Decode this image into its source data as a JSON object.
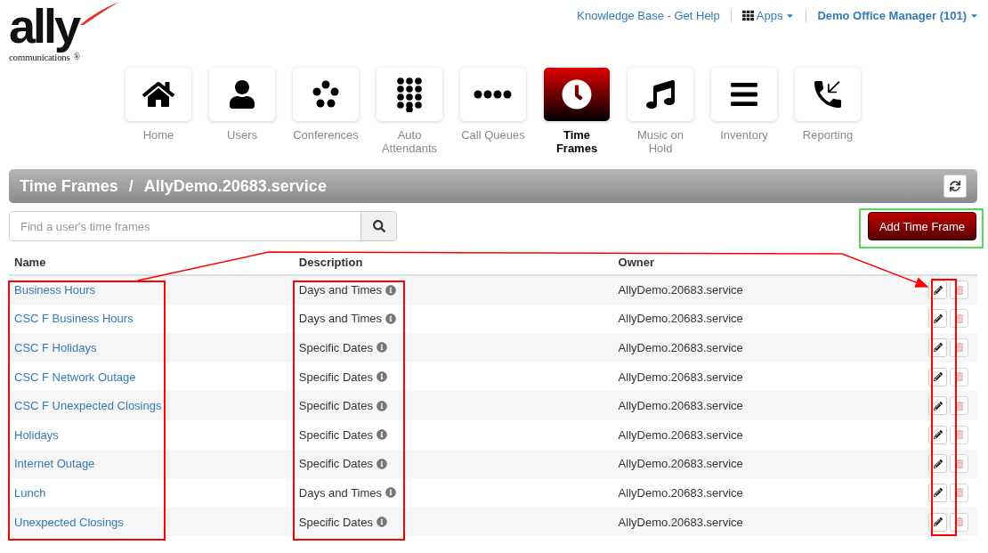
{
  "logo": {
    "wordmark": "ally",
    "tagline": "communications",
    "mark": "®"
  },
  "top_links": {
    "help": "Knowledge Base - Get Help",
    "apps": "Apps",
    "user": "Demo Office Manager (101)"
  },
  "nav": [
    {
      "label": "Home",
      "selected": false
    },
    {
      "label": "Users",
      "selected": false
    },
    {
      "label": "Conferences",
      "selected": false
    },
    {
      "label": "Auto Attendants",
      "selected": false
    },
    {
      "label": "Call Queues",
      "selected": false
    },
    {
      "label": "Time Frames",
      "selected": true
    },
    {
      "label": "Music on Hold",
      "selected": false
    },
    {
      "label": "Inventory",
      "selected": false
    },
    {
      "label": "Reporting",
      "selected": false
    }
  ],
  "title_bar": {
    "section": "Time Frames",
    "separator": "/",
    "domain": "AllyDemo.20683.service"
  },
  "search": {
    "placeholder": "Find a user's time frames"
  },
  "add_button": "Add Time Frame",
  "table": {
    "columns": [
      "Name",
      "Description",
      "Owner"
    ],
    "rows": [
      {
        "name": "Business Hours",
        "description": "Days and Times",
        "owner": "AllyDemo.20683.service"
      },
      {
        "name": "CSC F Business Hours",
        "description": "Days and Times",
        "owner": "AllyDemo.20683.service"
      },
      {
        "name": "CSC F Holidays",
        "description": "Specific Dates",
        "owner": "AllyDemo.20683.service"
      },
      {
        "name": "CSC F Network Outage",
        "description": "Specific Dates",
        "owner": "AllyDemo.20683.service"
      },
      {
        "name": "CSC F Unexpected Closings",
        "description": "Specific Dates",
        "owner": "AllyDemo.20683.service"
      },
      {
        "name": "Holidays",
        "description": "Specific Dates",
        "owner": "AllyDemo.20683.service"
      },
      {
        "name": "Internet Outage",
        "description": "Specific Dates",
        "owner": "AllyDemo.20683.service"
      },
      {
        "name": "Lunch",
        "description": "Days and Times",
        "owner": "AllyDemo.20683.service"
      },
      {
        "name": "Unexpected Closings",
        "description": "Specific Dates",
        "owner": "AllyDemo.20683.service"
      }
    ]
  }
}
